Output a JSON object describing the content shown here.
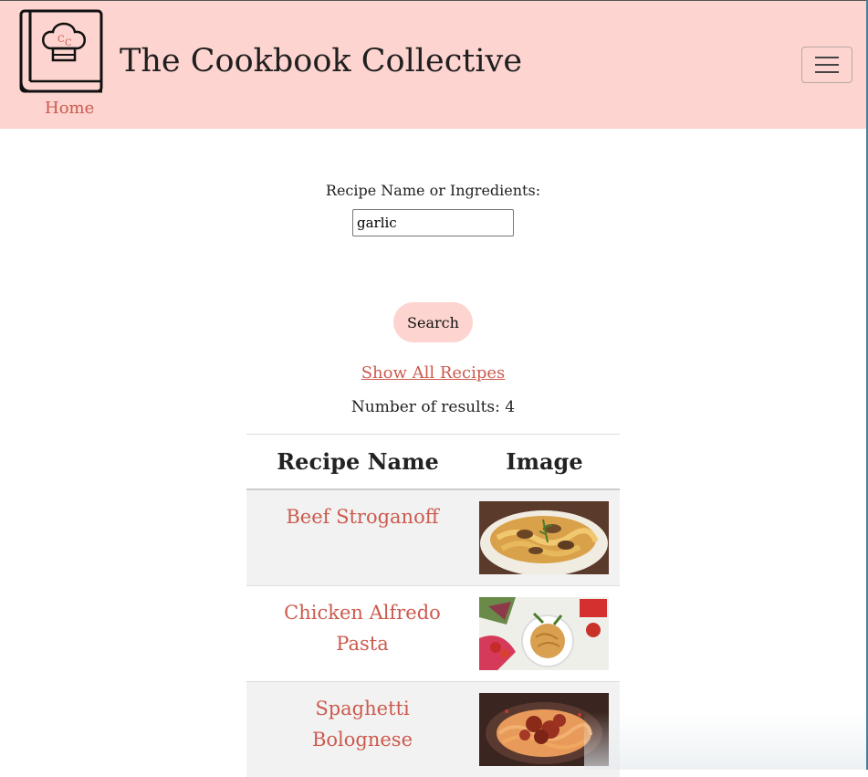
{
  "header": {
    "site_title": "The Cookbook Collective",
    "home_label": "Home",
    "logo_monogram": "CC",
    "menu_icon": "hamburger-menu-icon"
  },
  "search": {
    "label": "Recipe Name or Ingredients:",
    "value": "garlic",
    "button_label": "Search",
    "show_all_label": "Show All Recipes",
    "result_count_text": "Number of results: 4"
  },
  "table": {
    "headers": [
      "Recipe Name",
      "Image"
    ],
    "rows": [
      {
        "name": "Beef Stroganoff",
        "image": "beef-stroganoff-photo"
      },
      {
        "name": "Chicken Alfredo Pasta",
        "image": "chicken-alfredo-photo"
      },
      {
        "name": "Spaghetti Bolognese",
        "image": "spaghetti-bolognese-photo"
      }
    ]
  },
  "colors": {
    "accent_pink": "#fdd4cf",
    "link_red": "#cc5a4e"
  }
}
